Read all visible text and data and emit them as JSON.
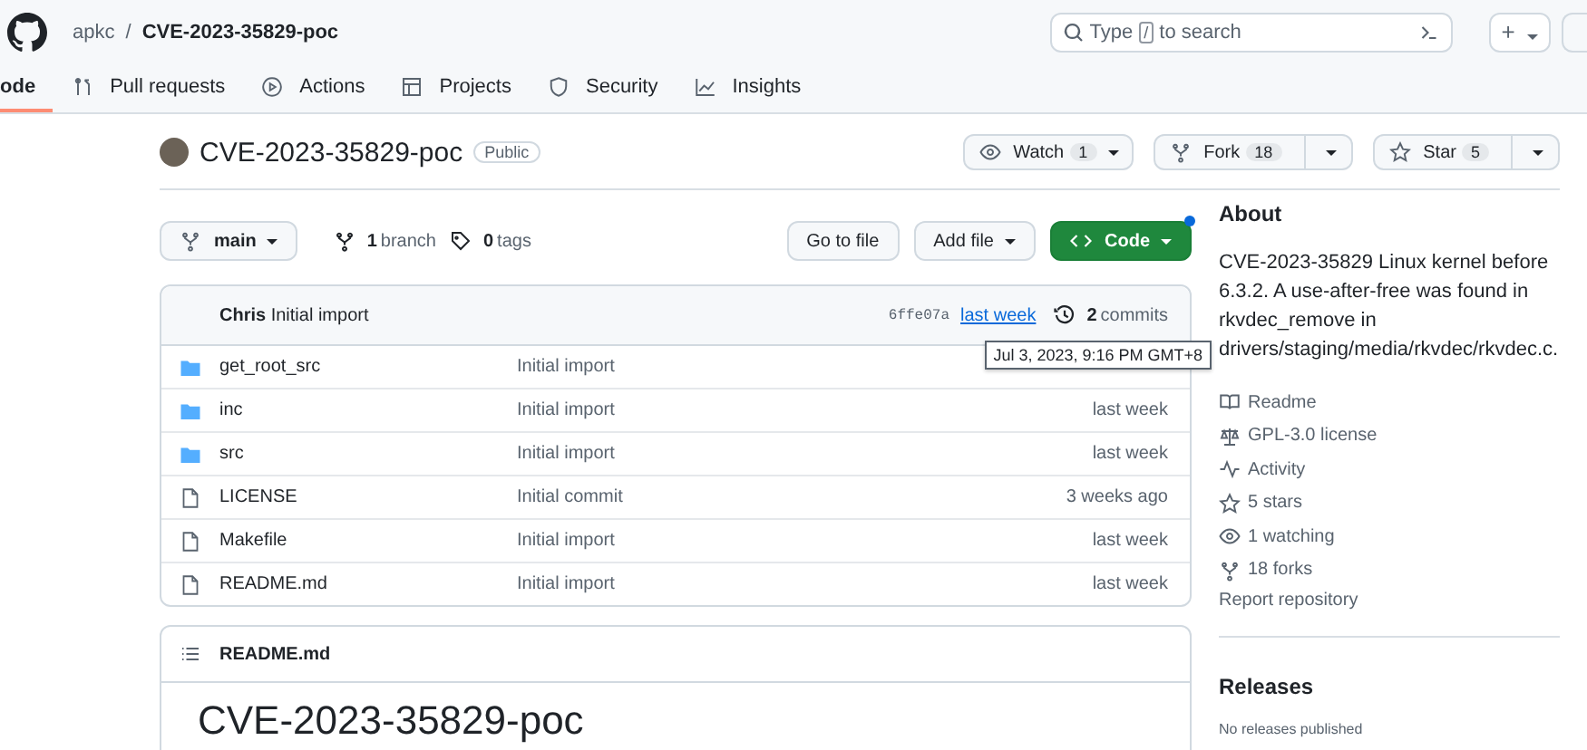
{
  "header": {
    "owner": "apkc",
    "separator": "/",
    "repo": "CVE-2023-35829-poc",
    "search_placeholder_before": "Type",
    "search_key": "/",
    "search_placeholder_after": "to search",
    "new_caret": "+"
  },
  "tabs": [
    {
      "label": "ode",
      "selected": true
    },
    {
      "label": "Pull requests",
      "selected": false
    },
    {
      "label": "Actions",
      "selected": false
    },
    {
      "label": "Projects",
      "selected": false
    },
    {
      "label": "Security",
      "selected": false
    },
    {
      "label": "Insights",
      "selected": false
    }
  ],
  "repo": {
    "name": "CVE-2023-35829-poc",
    "visibility": "Public",
    "actions": [
      {
        "label": "Watch",
        "count": "1",
        "split": false
      },
      {
        "label": "Fork",
        "count": "18",
        "split": true
      },
      {
        "label": "Star",
        "count": "5",
        "split": true
      }
    ]
  },
  "toolbar": {
    "branch": "main",
    "branches_count": "1",
    "branches_label": "branch",
    "tags_count": "0",
    "tags_label": "tags",
    "go_to_file": "Go to file",
    "add_file": "Add file",
    "code": "Code"
  },
  "commit": {
    "author": "Chris",
    "message": "Initial import",
    "sha": "6ffe07a",
    "when": "last week",
    "commits_count": "2",
    "commits_label": "commits"
  },
  "tooltip": "Jul 3, 2023, 9:16 PM GMT+8",
  "files": [
    {
      "name": "get_root_src",
      "kind": "folder",
      "message": "Initial import"
    },
    {
      "name": "inc",
      "kind": "folder",
      "message": "Initial import",
      "date": "last week"
    },
    {
      "name": "src",
      "kind": "folder",
      "message": "Initial import",
      "date": "last week"
    },
    {
      "name": "LICENSE",
      "kind": "file",
      "message": "Initial commit",
      "date": "3 weeks ago"
    },
    {
      "name": "Makefile",
      "kind": "file",
      "message": "Initial import",
      "date": "last week"
    },
    {
      "name": "README.md",
      "kind": "file",
      "message": "Initial import",
      "date": "last week"
    }
  ],
  "readme": {
    "filename": "README.md",
    "heading": "CVE-2023-35829-poc"
  },
  "about": {
    "title": "About",
    "description": "CVE-2023-35829 Linux kernel before 6.3.2. A use-after-free was found in rkvdec_remove in drivers/staging/media/rkvdec/rkvdec.c.",
    "links": [
      {
        "label": "Readme"
      },
      {
        "label": "GPL-3.0 license"
      },
      {
        "label": "Activity"
      },
      {
        "label": "5 stars"
      },
      {
        "label": "1 watching"
      },
      {
        "label": "18 forks"
      }
    ],
    "report": "Report repository"
  },
  "releases": {
    "title": "Releases",
    "empty": "No releases published"
  }
}
